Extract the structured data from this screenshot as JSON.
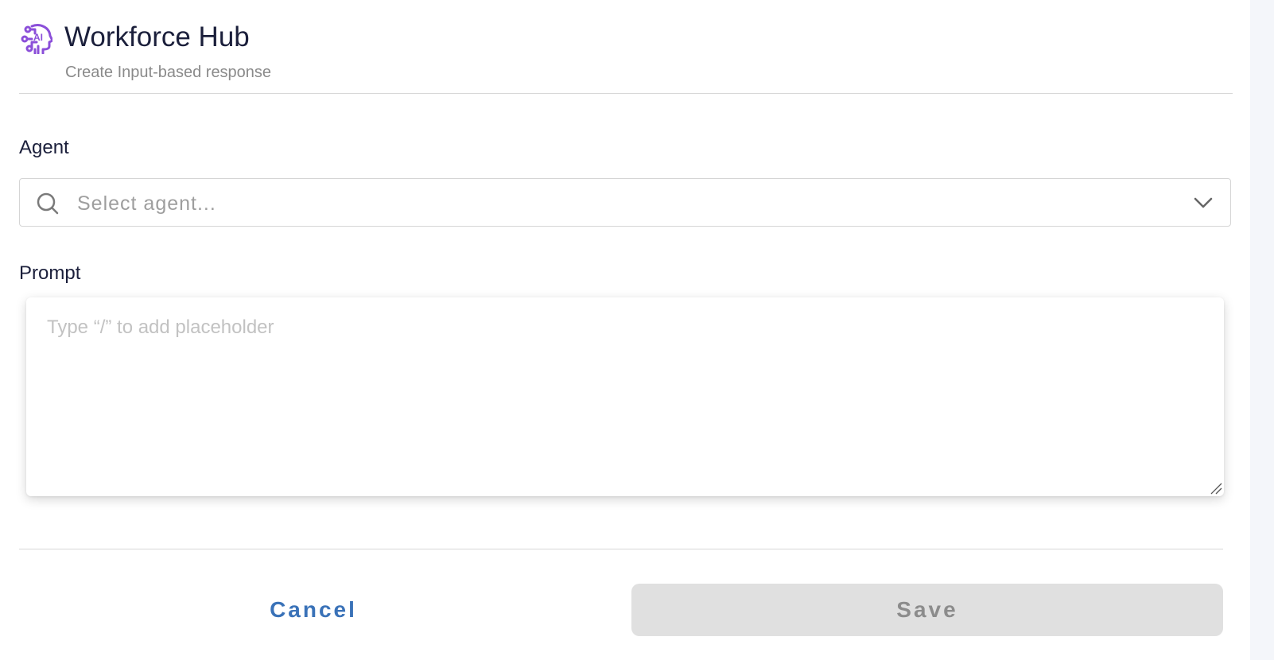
{
  "header": {
    "icon": "ai-head-icon",
    "title": "Workforce Hub",
    "subtitle": "Create Input-based response",
    "accent_color": "#8b4fd9"
  },
  "agent": {
    "label": "Agent",
    "placeholder": "Select agent...",
    "value": "",
    "search_icon": "search-icon",
    "dropdown_icon": "chevron-down-icon"
  },
  "prompt": {
    "label": "Prompt",
    "placeholder": "Type “/” to add placeholder",
    "value": ""
  },
  "actions": {
    "cancel_label": "Cancel",
    "save_label": "Save",
    "cancel_color": "#3a72b8",
    "save_disabled": true
  }
}
